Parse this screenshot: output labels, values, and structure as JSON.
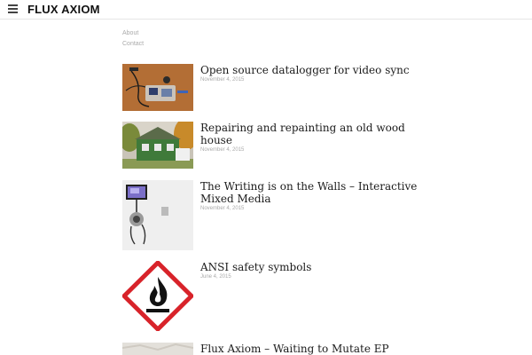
{
  "site": {
    "title": "FLUX AXIOM"
  },
  "nav": {
    "items": [
      "About",
      "Contact"
    ]
  },
  "posts": [
    {
      "title": "Open source datalogger for video sync",
      "date": "November 4, 2015"
    },
    {
      "title": "Repairing and repainting an old wood house",
      "date": "November 4, 2015"
    },
    {
      "title": "The Writing is on the Walls – Interactive Mixed Media",
      "date": "November 4, 2015"
    },
    {
      "title": "ANSI safety symbols",
      "date": "June 4, 2015"
    },
    {
      "title": "Flux Axiom – Waiting to Mutate EP",
      "date": ""
    }
  ],
  "colors": {
    "hazard_red": "#d8232a",
    "house_green": "#3f7a3a"
  }
}
